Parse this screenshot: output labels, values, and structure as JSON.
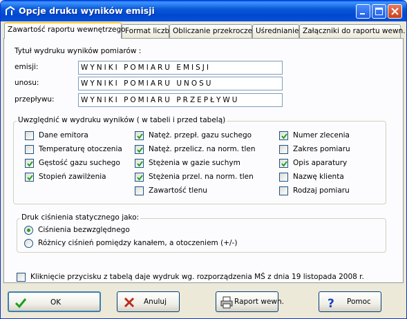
{
  "window": {
    "title": "Opcje druku wyników emisji"
  },
  "tabs": [
    {
      "label": "Zawartość raportu wewnętrzego",
      "active": true
    },
    {
      "label": "Format liczb",
      "active": false
    },
    {
      "label": "Obliczanie przekroczeń",
      "active": false
    },
    {
      "label": "Uśrednianie",
      "active": false
    },
    {
      "label": "Załączniki do raportu wewn.",
      "active": false
    }
  ],
  "titles_section": {
    "heading": "Tytuł wydruku wyników pomiarów :",
    "fields": [
      {
        "label": "emisji:",
        "value": "WYNIKI POMIARU EMISJI"
      },
      {
        "label": "unosu:",
        "value": "WYNIKI POMIARU UNOSU"
      },
      {
        "label": "przepływu:",
        "value": "WYNIKI POMIARU PRZEPŁYWU"
      }
    ]
  },
  "include_group": {
    "legend": "Uwzględnić w wydruku wyników ( w tabeli i przed tabelą)",
    "col1": [
      {
        "label": "Dane emitora",
        "checked": false
      },
      {
        "label": "Temperaturę otoczenia",
        "checked": false
      },
      {
        "label": "Gęstość gazu suchego",
        "checked": true
      },
      {
        "label": "Stopień zawilżenia",
        "checked": true
      }
    ],
    "col2": [
      {
        "label": "Natęż. przepł. gazu suchego",
        "checked": true
      },
      {
        "label": "Natęż. przelicz. na norm. tlen",
        "checked": true
      },
      {
        "label": "Stężenia w gazie suchym",
        "checked": true
      },
      {
        "label": "Stężenia przel. na norm. tlen",
        "checked": true
      },
      {
        "label": "Zawartość tlenu",
        "checked": false
      }
    ],
    "col3": [
      {
        "label": "Numer zlecenia",
        "checked": true
      },
      {
        "label": "Zakres pomiaru",
        "checked": false
      },
      {
        "label": "Opis aparatury",
        "checked": true
      },
      {
        "label": "Nazwę klienta",
        "checked": false
      },
      {
        "label": "Rodzaj pomiaru",
        "checked": false
      }
    ]
  },
  "pressure_group": {
    "legend": "Druk ciśnienia statycznego jako:",
    "options": [
      {
        "label": "Ciśnienia bezwzględnego",
        "selected": true
      },
      {
        "label": "Różnicy ciśnień pomiędzy kanałem, a otoczeniem (+/-)",
        "selected": false
      }
    ]
  },
  "regulation_checkbox": {
    "label": "Kliknięcie przycisku z tabelą daje wydruk wg. rozporządzenia MŚ z dnia 19 listopada 2008 r.",
    "checked": false
  },
  "buttons": {
    "ok": "OK",
    "cancel": "Anuluj",
    "report": "Raport wewn.",
    "help": "Pomoc"
  },
  "colors": {
    "titlebar": "#0a59d8",
    "tab_highlight": "#ffc83c",
    "check": "#21a121"
  }
}
